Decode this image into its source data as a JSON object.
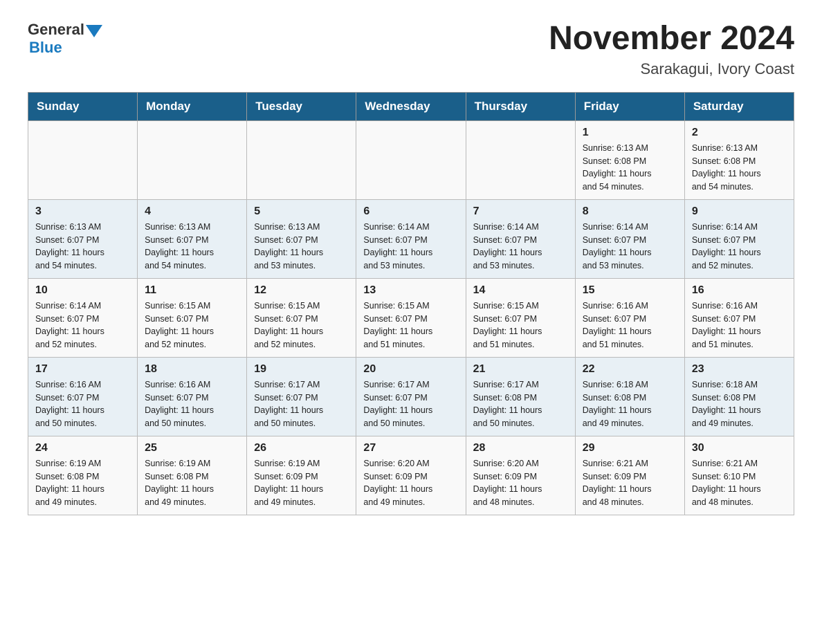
{
  "header": {
    "logo_general": "General",
    "logo_blue": "Blue",
    "month_title": "November 2024",
    "location": "Sarakagui, Ivory Coast"
  },
  "days_of_week": [
    "Sunday",
    "Monday",
    "Tuesday",
    "Wednesday",
    "Thursday",
    "Friday",
    "Saturday"
  ],
  "weeks": [
    {
      "days": [
        {
          "num": "",
          "info": ""
        },
        {
          "num": "",
          "info": ""
        },
        {
          "num": "",
          "info": ""
        },
        {
          "num": "",
          "info": ""
        },
        {
          "num": "",
          "info": ""
        },
        {
          "num": "1",
          "info": "Sunrise: 6:13 AM\nSunset: 6:08 PM\nDaylight: 11 hours\nand 54 minutes."
        },
        {
          "num": "2",
          "info": "Sunrise: 6:13 AM\nSunset: 6:08 PM\nDaylight: 11 hours\nand 54 minutes."
        }
      ]
    },
    {
      "days": [
        {
          "num": "3",
          "info": "Sunrise: 6:13 AM\nSunset: 6:07 PM\nDaylight: 11 hours\nand 54 minutes."
        },
        {
          "num": "4",
          "info": "Sunrise: 6:13 AM\nSunset: 6:07 PM\nDaylight: 11 hours\nand 54 minutes."
        },
        {
          "num": "5",
          "info": "Sunrise: 6:13 AM\nSunset: 6:07 PM\nDaylight: 11 hours\nand 53 minutes."
        },
        {
          "num": "6",
          "info": "Sunrise: 6:14 AM\nSunset: 6:07 PM\nDaylight: 11 hours\nand 53 minutes."
        },
        {
          "num": "7",
          "info": "Sunrise: 6:14 AM\nSunset: 6:07 PM\nDaylight: 11 hours\nand 53 minutes."
        },
        {
          "num": "8",
          "info": "Sunrise: 6:14 AM\nSunset: 6:07 PM\nDaylight: 11 hours\nand 53 minutes."
        },
        {
          "num": "9",
          "info": "Sunrise: 6:14 AM\nSunset: 6:07 PM\nDaylight: 11 hours\nand 52 minutes."
        }
      ]
    },
    {
      "days": [
        {
          "num": "10",
          "info": "Sunrise: 6:14 AM\nSunset: 6:07 PM\nDaylight: 11 hours\nand 52 minutes."
        },
        {
          "num": "11",
          "info": "Sunrise: 6:15 AM\nSunset: 6:07 PM\nDaylight: 11 hours\nand 52 minutes."
        },
        {
          "num": "12",
          "info": "Sunrise: 6:15 AM\nSunset: 6:07 PM\nDaylight: 11 hours\nand 52 minutes."
        },
        {
          "num": "13",
          "info": "Sunrise: 6:15 AM\nSunset: 6:07 PM\nDaylight: 11 hours\nand 51 minutes."
        },
        {
          "num": "14",
          "info": "Sunrise: 6:15 AM\nSunset: 6:07 PM\nDaylight: 11 hours\nand 51 minutes."
        },
        {
          "num": "15",
          "info": "Sunrise: 6:16 AM\nSunset: 6:07 PM\nDaylight: 11 hours\nand 51 minutes."
        },
        {
          "num": "16",
          "info": "Sunrise: 6:16 AM\nSunset: 6:07 PM\nDaylight: 11 hours\nand 51 minutes."
        }
      ]
    },
    {
      "days": [
        {
          "num": "17",
          "info": "Sunrise: 6:16 AM\nSunset: 6:07 PM\nDaylight: 11 hours\nand 50 minutes."
        },
        {
          "num": "18",
          "info": "Sunrise: 6:16 AM\nSunset: 6:07 PM\nDaylight: 11 hours\nand 50 minutes."
        },
        {
          "num": "19",
          "info": "Sunrise: 6:17 AM\nSunset: 6:07 PM\nDaylight: 11 hours\nand 50 minutes."
        },
        {
          "num": "20",
          "info": "Sunrise: 6:17 AM\nSunset: 6:07 PM\nDaylight: 11 hours\nand 50 minutes."
        },
        {
          "num": "21",
          "info": "Sunrise: 6:17 AM\nSunset: 6:08 PM\nDaylight: 11 hours\nand 50 minutes."
        },
        {
          "num": "22",
          "info": "Sunrise: 6:18 AM\nSunset: 6:08 PM\nDaylight: 11 hours\nand 49 minutes."
        },
        {
          "num": "23",
          "info": "Sunrise: 6:18 AM\nSunset: 6:08 PM\nDaylight: 11 hours\nand 49 minutes."
        }
      ]
    },
    {
      "days": [
        {
          "num": "24",
          "info": "Sunrise: 6:19 AM\nSunset: 6:08 PM\nDaylight: 11 hours\nand 49 minutes."
        },
        {
          "num": "25",
          "info": "Sunrise: 6:19 AM\nSunset: 6:08 PM\nDaylight: 11 hours\nand 49 minutes."
        },
        {
          "num": "26",
          "info": "Sunrise: 6:19 AM\nSunset: 6:09 PM\nDaylight: 11 hours\nand 49 minutes."
        },
        {
          "num": "27",
          "info": "Sunrise: 6:20 AM\nSunset: 6:09 PM\nDaylight: 11 hours\nand 49 minutes."
        },
        {
          "num": "28",
          "info": "Sunrise: 6:20 AM\nSunset: 6:09 PM\nDaylight: 11 hours\nand 48 minutes."
        },
        {
          "num": "29",
          "info": "Sunrise: 6:21 AM\nSunset: 6:09 PM\nDaylight: 11 hours\nand 48 minutes."
        },
        {
          "num": "30",
          "info": "Sunrise: 6:21 AM\nSunset: 6:10 PM\nDaylight: 11 hours\nand 48 minutes."
        }
      ]
    }
  ]
}
